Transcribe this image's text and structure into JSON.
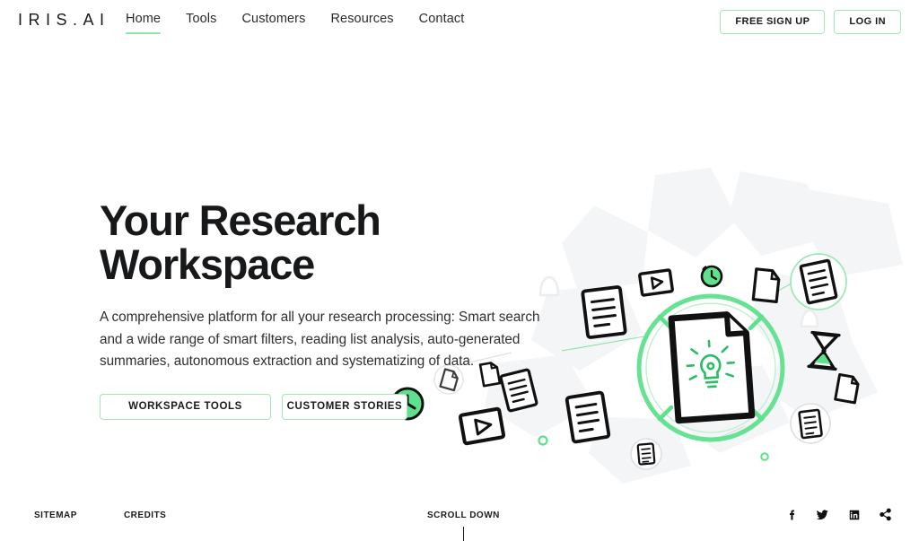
{
  "brand": {
    "logo_text": "IRIS.AI",
    "accent_green": "#5FE08C",
    "accent_green_light": "#9FE8B8",
    "underline_green": "#8EE6A8",
    "text_dark": "#17181a"
  },
  "header": {
    "nav": [
      {
        "label": "Home",
        "active": true
      },
      {
        "label": "Tools",
        "active": false
      },
      {
        "label": "Customers",
        "active": false
      },
      {
        "label": "Resources",
        "active": false
      },
      {
        "label": "Contact",
        "active": false
      }
    ],
    "signup_label": "FREE SIGN UP",
    "login_label": "LOG IN"
  },
  "hero": {
    "title": "Your Research\nWorkspace",
    "description": "A comprehensive platform for all your research processing: Smart search and a wide range of smart filters, reading list analysis, auto-generated summaries, autonomous extraction and systematizing of data.",
    "primary_cta": "WORKSPACE TOOLS",
    "secondary_cta": "CUSTOMER STORIES"
  },
  "illustration": {
    "center_icon": "document-with-lightbulb-icon",
    "ring": "progress-ring",
    "floating_icons": [
      "video-play-icon",
      "history-clock-icon",
      "blank-page-icon",
      "text-document-icon",
      "hourglass-icon",
      "bell-icon",
      "circle-dot-icon"
    ]
  },
  "footer": {
    "sitemap_label": "SITEMAP",
    "credits_label": "CREDITS",
    "scroll_label": "SCROLL DOWN",
    "socials": [
      {
        "name": "facebook-icon"
      },
      {
        "name": "twitter-icon"
      },
      {
        "name": "linkedin-icon"
      },
      {
        "name": "share-icon"
      }
    ]
  }
}
